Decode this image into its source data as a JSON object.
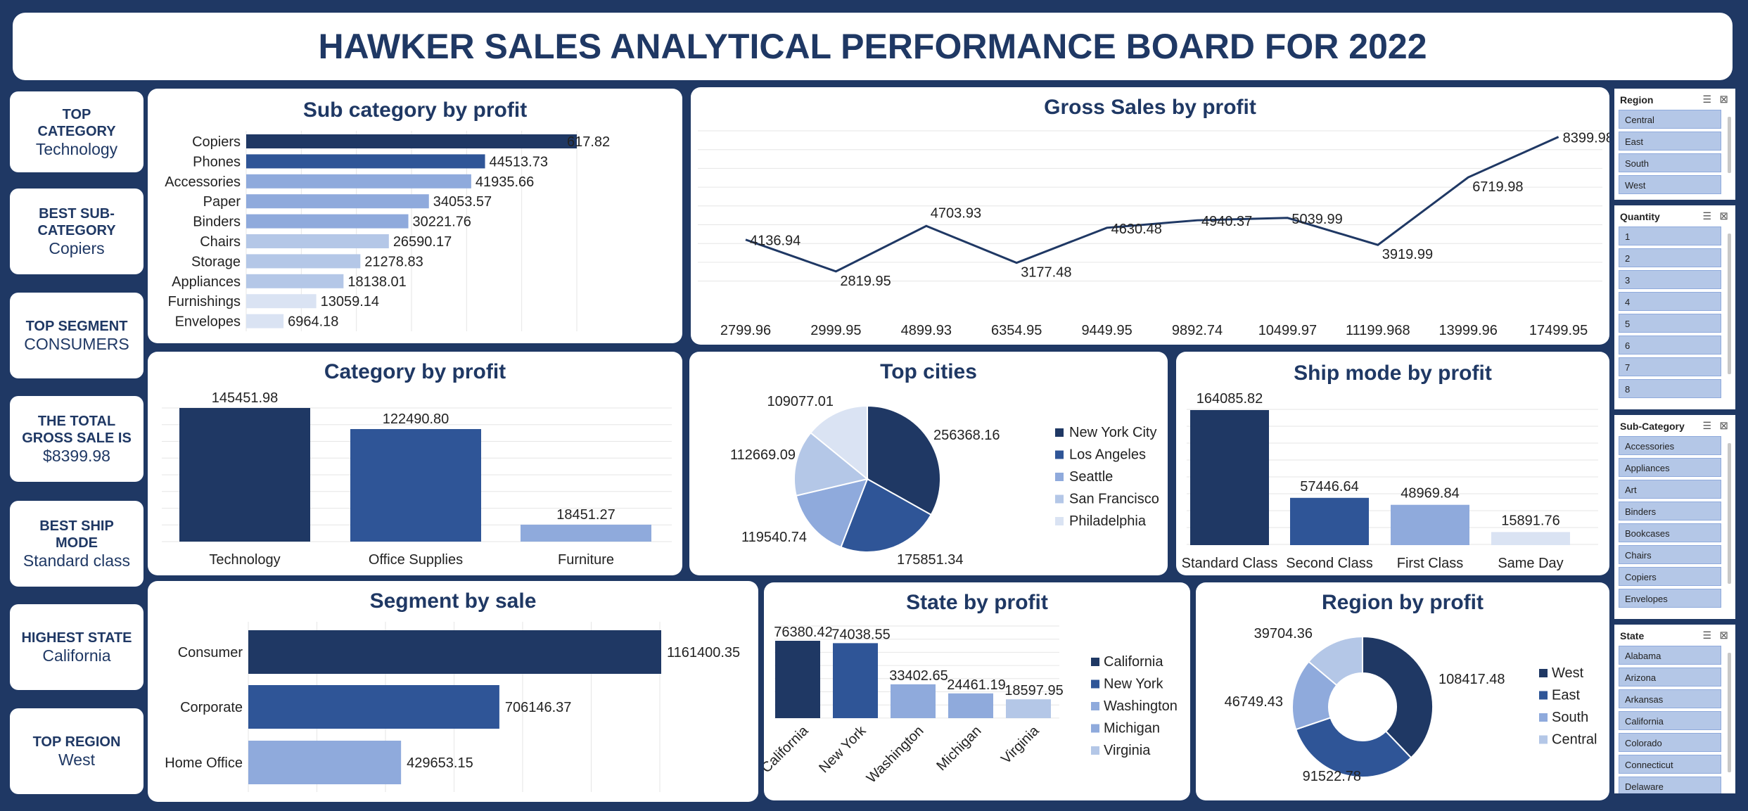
{
  "title": "HAWKER SALES ANALYTICAL PERFORMANCE BOARD FOR 2022",
  "kpis": [
    {
      "label": "TOP CATEGORY",
      "value": "Technology"
    },
    {
      "label": "BEST SUB-CATEGORY",
      "value": "Copiers"
    },
    {
      "label": "TOP SEGMENT",
      "value": "CONSUMERS"
    },
    {
      "label": "THE TOTAL GROSS SALE IS",
      "value": "$8399.98"
    },
    {
      "label": "BEST SHIP MODE",
      "value": "Standard class"
    },
    {
      "label": "HIGHEST STATE",
      "value": "California"
    },
    {
      "label": "TOP REGION",
      "value": "West"
    }
  ],
  "colors": {
    "dark": "#1f3864",
    "blue": "#2f5597",
    "mid": "#8faadc",
    "light": "#b4c7e7",
    "pale": "#dae3f3"
  },
  "chart_data": [
    {
      "id": "subcat",
      "type": "bar",
      "title": "Sub category by profit",
      "categories": [
        "Copiers",
        "Phones",
        "Accessories",
        "Paper",
        "Binders",
        "Chairs",
        "Storage",
        "Appliances",
        "Furnishings",
        "Envelopes"
      ],
      "values": [
        61617.82,
        44513.73,
        41935.66,
        34053.57,
        30221.76,
        26590.17,
        21278.83,
        18138.01,
        13059.14,
        6964.18
      ],
      "labels": [
        "617.82",
        "44513.73",
        "41935.66",
        "34053.57",
        "30221.76",
        "26590.17",
        "21278.83",
        "18138.01",
        "13059.14",
        "6964.18"
      ],
      "orientation": "horizontal"
    },
    {
      "id": "gross",
      "type": "line",
      "title": "Gross Sales by profit",
      "categories": [
        "2799.96",
        "2999.95",
        "4899.93",
        "6354.95",
        "9449.95",
        "9892.74",
        "10499.97",
        "11199.968",
        "13999.96",
        "17499.95"
      ],
      "values": [
        4136.94,
        2819.95,
        4703.93,
        3177.48,
        4630.48,
        4940.37,
        5039.99,
        3919.99,
        6719.98,
        8399.98
      ],
      "labels": [
        "4136.94",
        "2819.95",
        "4703.93",
        "3177.48",
        "4630.48",
        "4940.37",
        "5039.99",
        "3919.99",
        "6719.98",
        "8399.98"
      ]
    },
    {
      "id": "category",
      "type": "bar",
      "title": "Category by profit",
      "categories": [
        "Technology",
        "Office Supplies",
        "Furniture"
      ],
      "values": [
        145451.98,
        122490.8,
        18451.27
      ],
      "labels": [
        "145451.98",
        "122490.80",
        "18451.27"
      ]
    },
    {
      "id": "cities",
      "type": "pie",
      "title": "Top cities",
      "categories": [
        "New York City",
        "Los Angeles",
        "Seattle",
        "San Francisco",
        "Philadelphia"
      ],
      "values": [
        256368.16,
        175851.34,
        119540.74,
        112669.09,
        109077.01
      ],
      "labels": [
        "256368.16",
        "175851.34",
        "119540.74",
        "112669.09",
        "109077.01"
      ],
      "legend": "right"
    },
    {
      "id": "ship",
      "type": "bar",
      "title": "Ship mode by profit",
      "categories": [
        "Standard Class",
        "Second Class",
        "First Class",
        "Same Day"
      ],
      "values": [
        164085.82,
        57446.64,
        48969.84,
        15891.76
      ],
      "labels": [
        "164085.82",
        "57446.64",
        "48969.84",
        "15891.76"
      ]
    },
    {
      "id": "segment",
      "type": "bar",
      "title": "Segment by sale",
      "categories": [
        "Consumer",
        "Corporate",
        "Home Office"
      ],
      "values": [
        1161400.35,
        706146.37,
        429653.15
      ],
      "labels": [
        "1161400.35",
        "706146.37",
        "429653.15"
      ],
      "orientation": "horizontal"
    },
    {
      "id": "state",
      "type": "bar",
      "title": "State by profit",
      "categories": [
        "California",
        "New York",
        "Washington",
        "Michigan",
        "Virginia"
      ],
      "values": [
        76380.42,
        74038.55,
        33402.65,
        24461.19,
        18597.95
      ],
      "labels": [
        "76380.42",
        "74038.55",
        "33402.65",
        "24461.19",
        "18597.95"
      ],
      "legend": "right"
    },
    {
      "id": "region",
      "type": "pie",
      "title": "Region by profit",
      "categories": [
        "West",
        "East",
        "South",
        "Central"
      ],
      "values": [
        108417.48,
        91522.78,
        46749.43,
        39704.36
      ],
      "labels": [
        "108417.48",
        "91522.78",
        "46749.43",
        "39704.36"
      ],
      "legend": "right",
      "donut": true
    }
  ],
  "slicers": [
    {
      "title": "Region",
      "items": [
        "Central",
        "East",
        "South",
        "West"
      ]
    },
    {
      "title": "Quantity",
      "items": [
        "1",
        "2",
        "3",
        "4",
        "5",
        "6",
        "7",
        "8"
      ]
    },
    {
      "title": "Sub-Category",
      "items": [
        "Accessories",
        "Appliances",
        "Art",
        "Binders",
        "Bookcases",
        "Chairs",
        "Copiers",
        "Envelopes"
      ]
    },
    {
      "title": "State",
      "items": [
        "Alabama",
        "Arizona",
        "Arkansas",
        "California",
        "Colorado",
        "Connecticut",
        "Delaware"
      ]
    }
  ]
}
